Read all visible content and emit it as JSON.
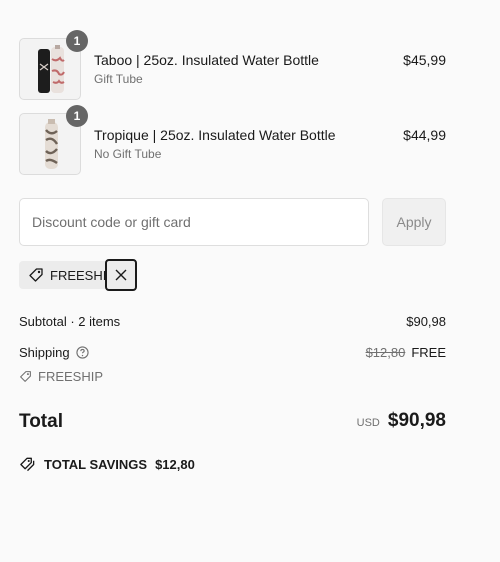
{
  "line_items": [
    {
      "quantity": "1",
      "title": "Taboo | 25oz. Insulated Water Bottle",
      "variant": "Gift Tube",
      "price": "$45,99"
    },
    {
      "quantity": "1",
      "title": "Tropique | 25oz. Insulated Water Bottle",
      "variant": "No Gift Tube",
      "price": "$44,99"
    }
  ],
  "discount": {
    "placeholder": "Discount code or gift card",
    "value": "",
    "apply_label": "Apply",
    "applied_code": "FREESHIP"
  },
  "summary": {
    "subtotal_label": "Subtotal · 2 items",
    "subtotal_value": "$90,98",
    "shipping_label": "Shipping",
    "shipping_original": "$12,80",
    "shipping_value": "FREE",
    "shipping_code": "FREESHIP",
    "total_label": "Total",
    "currency": "USD",
    "total_value": "$90,98",
    "savings_label": "TOTAL SAVINGS",
    "savings_value": "$12,80"
  },
  "icons": {
    "tag": "tag-icon",
    "help": "help-circle-icon",
    "close": "close-icon",
    "savings": "tags-icon"
  }
}
